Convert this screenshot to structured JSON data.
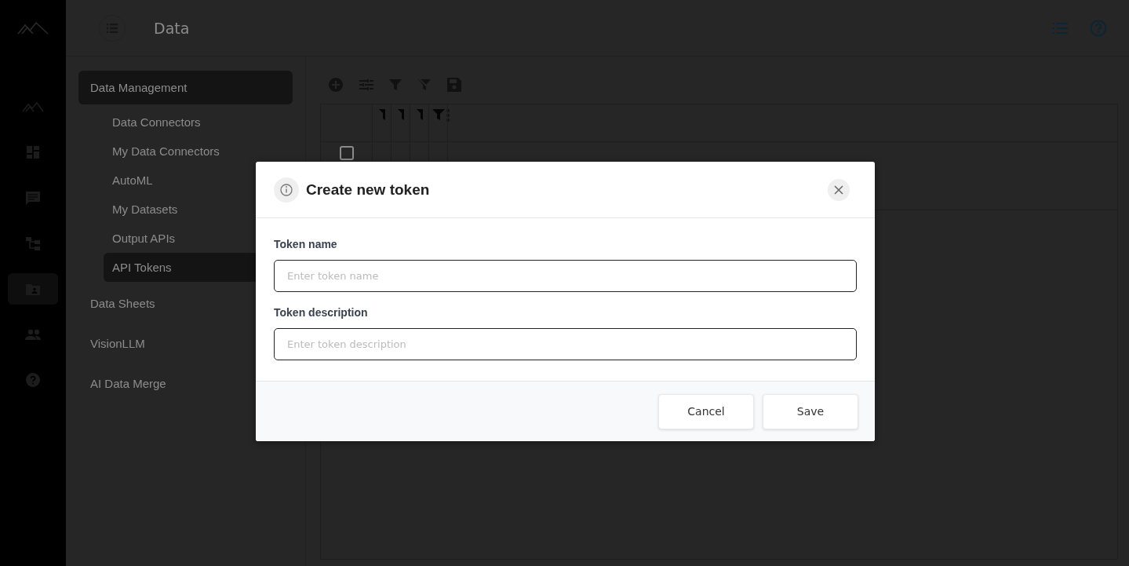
{
  "header": {
    "title": "Data"
  },
  "rail": [
    {
      "kind": "mountain",
      "selected": false
    },
    {
      "kind": "dashboard",
      "selected": false
    },
    {
      "kind": "chat",
      "selected": false
    },
    {
      "kind": "tree",
      "selected": false
    },
    {
      "kind": "folder",
      "selected": true
    },
    {
      "kind": "people",
      "selected": false
    },
    {
      "kind": "help",
      "selected": false
    }
  ],
  "sidebar": {
    "items": [
      {
        "label": "Data Management",
        "selected": true,
        "children": [
          {
            "label": "Data Connectors",
            "selected": false
          },
          {
            "label": "My Data Connectors",
            "selected": false
          },
          {
            "label": "AutoML",
            "selected": false
          },
          {
            "label": "My Datasets",
            "selected": false
          },
          {
            "label": "Output APIs",
            "selected": false
          },
          {
            "label": "API Tokens",
            "selected": true
          }
        ]
      },
      {
        "label": "Data Sheets",
        "selected": false
      },
      {
        "label": "VisionLLM",
        "selected": false
      },
      {
        "label": "AI Data Merge",
        "selected": false
      }
    ]
  },
  "grid": {
    "rows": [
      {
        "checked": false
      }
    ]
  },
  "dialog": {
    "title": "Create new token",
    "fields": [
      {
        "label": "Token name",
        "placeholder": "Enter token name"
      },
      {
        "label": "Token description",
        "placeholder": "Enter token description"
      }
    ],
    "buttons": [
      "Cancel",
      "Save"
    ]
  }
}
